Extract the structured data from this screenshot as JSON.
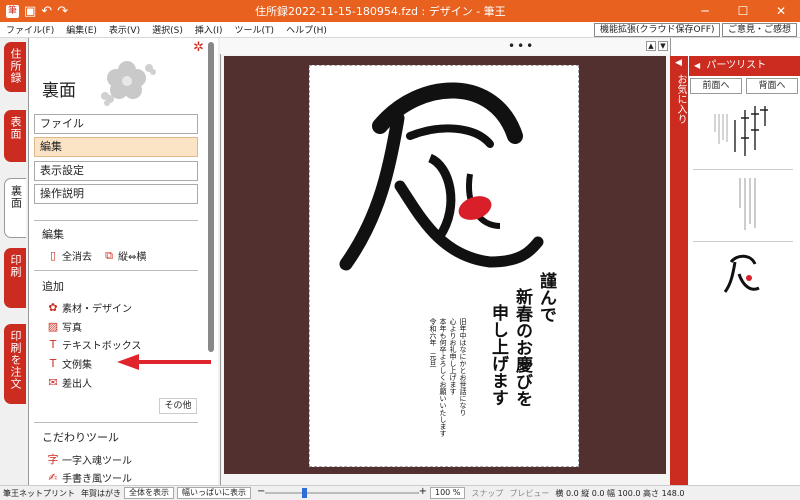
{
  "window": {
    "title": "住所録2022-11-15-180954.fzd : デザイン - 筆王",
    "accent": "#e8611f",
    "brand_red": "#cc2b1f"
  },
  "menu": {
    "items": [
      "ファイル(F)",
      "編集(E)",
      "表示(V)",
      "選択(S)",
      "挿入(I)",
      "ツール(T)",
      "ヘルプ(H)"
    ],
    "feature_button": "機能拡張(クラウド保存OFF)",
    "feedback_button": "ご意見・ご感想"
  },
  "left_tabs": [
    "住所録",
    "表面",
    "裏面",
    "印刷",
    "印刷を注文"
  ],
  "left_panel": {
    "heading": "裏面",
    "nav": [
      "ファイル",
      "編集",
      "表示設定",
      "操作説明"
    ],
    "section_edit": "編集",
    "clear_all": "全消去",
    "vertical_horizontal": "縦⇔横",
    "section_add": "追加",
    "add_items": [
      "素材・デザイン",
      "写真",
      "テキストボックス",
      "文例集",
      "差出人"
    ],
    "other_button": "その他",
    "section_tools": "こだわりツール",
    "tool_items": [
      "一字入魂ツール",
      "手書き風ツール"
    ]
  },
  "card": {
    "big_char": "辰",
    "greeting_col1": "謹んで",
    "greeting_col2": "新春のお慶びを",
    "greeting_col3": "申し上げます",
    "body_lines": [
      "旧年中はなにかとお世話になり",
      "心よりお礼申し上げます",
      "本年も何卒よろしくお願いいたします",
      "令和六年　元旦"
    ]
  },
  "right_panel": {
    "fav_label": "お気に入り",
    "header": "パーツリスト",
    "front_button": "前面へ",
    "back_button": "背面へ"
  },
  "status": {
    "app": "筆王ネットプリント",
    "paper": "年賀はがき",
    "fit_all": "全体を表示",
    "fit_width": "幅いっぱいに表示",
    "zoom": "100 %",
    "zoom_percent": 100,
    "zoom_range": [
      0,
      400
    ],
    "snap": "スナップ",
    "preview": "プレビュー",
    "metrics": "横 0.0  縦 0.0  幅 100.0  高さ 148.0"
  }
}
